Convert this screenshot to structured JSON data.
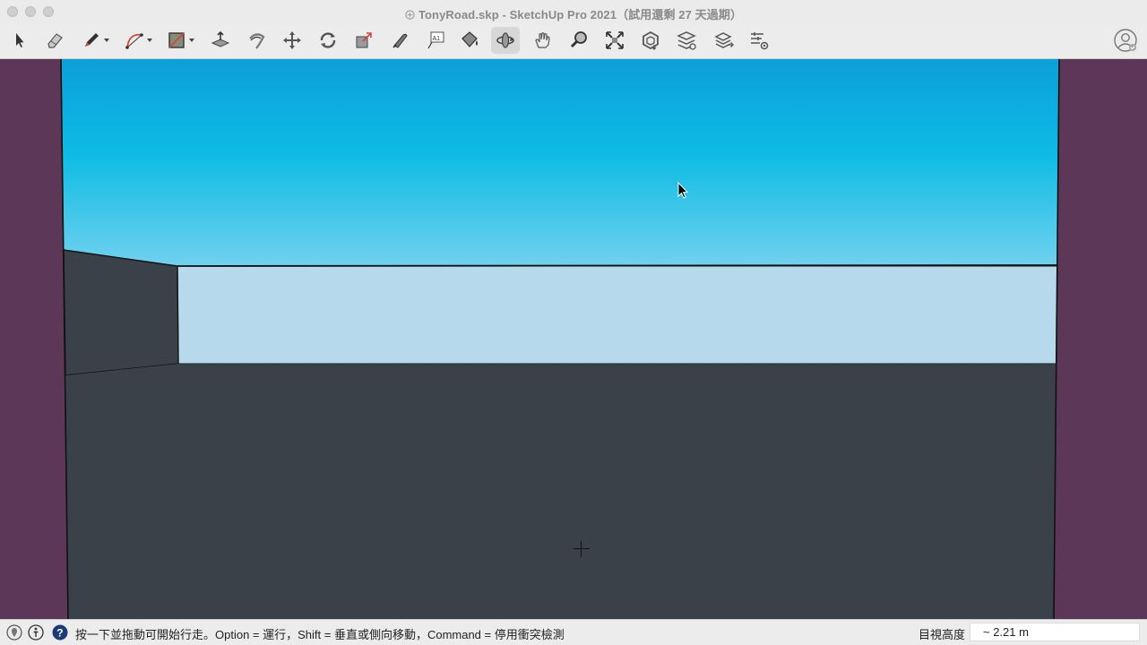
{
  "window": {
    "title": "TonyRoad.skp - SketchUp Pro 2021（試用還剩 27 天過期）"
  },
  "colors": {
    "viewport_border": "#5c3757",
    "sky_top": "#0ba4dc",
    "sky_bottom": "#6cd0ef",
    "back_wall": "#b6d9ec",
    "ground": "#3b4149",
    "side_wall": "#3b4149"
  },
  "toolbar": {
    "tools": [
      {
        "name": "select-tool",
        "icon": "arrow-icon"
      },
      {
        "name": "eraser-tool",
        "icon": "eraser-icon"
      },
      {
        "name": "line-tool",
        "icon": "pencil-icon",
        "dropdown": true
      },
      {
        "name": "arc-tool",
        "icon": "arc-icon",
        "dropdown": true
      },
      {
        "name": "shape-tool",
        "icon": "rectangle-icon",
        "dropdown": true
      },
      {
        "name": "push-pull-tool",
        "icon": "push-pull-icon"
      },
      {
        "name": "follow-me-tool",
        "icon": "follow-me-icon"
      },
      {
        "name": "move-tool",
        "icon": "move-icon"
      },
      {
        "name": "rotate-tool",
        "icon": "rotate-icon"
      },
      {
        "name": "scale-tool",
        "icon": "scale-icon"
      },
      {
        "name": "tape-measure-tool",
        "icon": "tape-measure-icon"
      },
      {
        "name": "text-tool",
        "icon": "text-icon"
      },
      {
        "name": "paint-bucket-tool",
        "icon": "paint-bucket-icon"
      },
      {
        "name": "orbit-tool",
        "icon": "orbit-icon",
        "active": true
      },
      {
        "name": "pan-tool",
        "icon": "hand-icon"
      },
      {
        "name": "zoom-tool",
        "icon": "zoom-icon"
      },
      {
        "name": "zoom-extents-tool",
        "icon": "zoom-extents-icon"
      },
      {
        "name": "3d-warehouse-button",
        "icon": "warehouse-icon"
      },
      {
        "name": "extension-warehouse-button",
        "icon": "extension-icon"
      },
      {
        "name": "layout-button",
        "icon": "layout-icon"
      },
      {
        "name": "extension-manager-button",
        "icon": "extension-manager-icon"
      }
    ],
    "text_icon_label": "A1"
  },
  "status": {
    "hint": "按一下並拖動可開始行走。Option = 運行，Shift = 垂直或側向移動，Command = 停用衝突檢測",
    "measure_label": "目視高度",
    "measure_value": "~ 2.21 m"
  }
}
